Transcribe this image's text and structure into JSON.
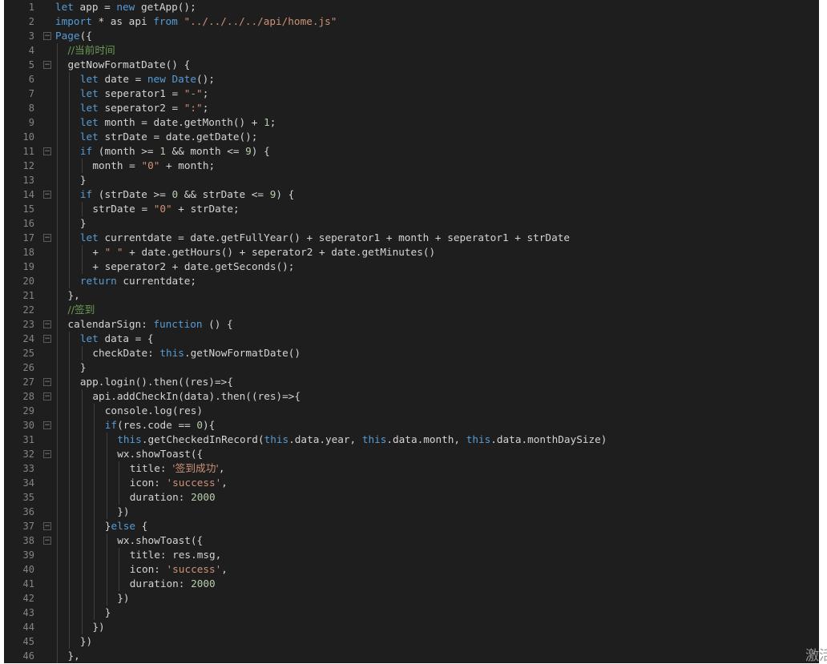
{
  "editor": {
    "colors": {
      "background": "#1e1e1e",
      "keyword": "#569cd6",
      "string": "#ce9178",
      "comment": "#6a9955",
      "number": "#b5cea8",
      "text": "#d4d4d4",
      "line_number": "#858585"
    },
    "fold_icon": "minus-box-icon",
    "lines": [
      {
        "n": "1",
        "fold": false,
        "indent": 0,
        "tokens": [
          [
            "kw",
            "let"
          ],
          [
            "pl",
            " app = "
          ],
          [
            "kw",
            "new"
          ],
          [
            "pl",
            " getApp();"
          ]
        ]
      },
      {
        "n": "2",
        "fold": false,
        "indent": 0,
        "tokens": [
          [
            "kw",
            "import"
          ],
          [
            "pl",
            " * as api "
          ],
          [
            "kw",
            "from"
          ],
          [
            "pl",
            " "
          ],
          [
            "str",
            "\"../../../../api/home.js\""
          ]
        ]
      },
      {
        "n": "3",
        "fold": true,
        "indent": 0,
        "tokens": [
          [
            "kw",
            "Page"
          ],
          [
            "pl",
            "({"
          ]
        ]
      },
      {
        "n": "4",
        "fold": false,
        "indent": 1,
        "tokens": [
          [
            "cm",
            "//当前时间"
          ]
        ]
      },
      {
        "n": "5",
        "fold": true,
        "indent": 1,
        "tokens": [
          [
            "pl",
            "getNowFormatDate() {"
          ]
        ]
      },
      {
        "n": "6",
        "fold": false,
        "indent": 2,
        "tokens": [
          [
            "kw",
            "let"
          ],
          [
            "pl",
            " date = "
          ],
          [
            "kw",
            "new"
          ],
          [
            "pl",
            " "
          ],
          [
            "kw",
            "Date"
          ],
          [
            "pl",
            "();"
          ]
        ]
      },
      {
        "n": "7",
        "fold": false,
        "indent": 2,
        "tokens": [
          [
            "kw",
            "let"
          ],
          [
            "pl",
            " seperator1 = "
          ],
          [
            "str",
            "\"-\""
          ],
          [
            "pl",
            ";"
          ]
        ]
      },
      {
        "n": "8",
        "fold": false,
        "indent": 2,
        "tokens": [
          [
            "kw",
            "let"
          ],
          [
            "pl",
            " seperator2 = "
          ],
          [
            "str",
            "\":\""
          ],
          [
            "pl",
            ";"
          ]
        ]
      },
      {
        "n": "9",
        "fold": false,
        "indent": 2,
        "tokens": [
          [
            "kw",
            "let"
          ],
          [
            "pl",
            " month = date.getMonth() + "
          ],
          [
            "num",
            "1"
          ],
          [
            "pl",
            ";"
          ]
        ]
      },
      {
        "n": "10",
        "fold": false,
        "indent": 2,
        "tokens": [
          [
            "kw",
            "let"
          ],
          [
            "pl",
            " strDate = date.getDate();"
          ]
        ]
      },
      {
        "n": "11",
        "fold": true,
        "indent": 2,
        "tokens": [
          [
            "kw",
            "if"
          ],
          [
            "pl",
            " (month >= "
          ],
          [
            "num",
            "1"
          ],
          [
            "pl",
            " && month <= "
          ],
          [
            "num",
            "9"
          ],
          [
            "pl",
            ") {"
          ]
        ]
      },
      {
        "n": "12",
        "fold": false,
        "indent": 3,
        "tokens": [
          [
            "pl",
            "month = "
          ],
          [
            "str",
            "\"0\""
          ],
          [
            "pl",
            " + month;"
          ]
        ]
      },
      {
        "n": "13",
        "fold": false,
        "indent": 2,
        "tokens": [
          [
            "pl",
            "}"
          ]
        ]
      },
      {
        "n": "14",
        "fold": true,
        "indent": 2,
        "tokens": [
          [
            "kw",
            "if"
          ],
          [
            "pl",
            " (strDate >= "
          ],
          [
            "num",
            "0"
          ],
          [
            "pl",
            " && strDate <= "
          ],
          [
            "num",
            "9"
          ],
          [
            "pl",
            ") {"
          ]
        ]
      },
      {
        "n": "15",
        "fold": false,
        "indent": 3,
        "tokens": [
          [
            "pl",
            "strDate = "
          ],
          [
            "str",
            "\"0\""
          ],
          [
            "pl",
            " + strDate;"
          ]
        ]
      },
      {
        "n": "16",
        "fold": false,
        "indent": 2,
        "tokens": [
          [
            "pl",
            "}"
          ]
        ]
      },
      {
        "n": "17",
        "fold": true,
        "indent": 2,
        "tokens": [
          [
            "kw",
            "let"
          ],
          [
            "pl",
            " currentdate = date.getFullYear() + seperator1 + month + seperator1 + strDate"
          ]
        ]
      },
      {
        "n": "18",
        "fold": false,
        "indent": 3,
        "tokens": [
          [
            "pl",
            "+ "
          ],
          [
            "str",
            "\" \""
          ],
          [
            "pl",
            " + date.getHours() + seperator2 + date.getMinutes()"
          ]
        ]
      },
      {
        "n": "19",
        "fold": false,
        "indent": 3,
        "tokens": [
          [
            "pl",
            "+ seperator2 + date.getSeconds();"
          ]
        ]
      },
      {
        "n": "20",
        "fold": false,
        "indent": 2,
        "tokens": [
          [
            "kw",
            "return"
          ],
          [
            "pl",
            " currentdate;"
          ]
        ]
      },
      {
        "n": "21",
        "fold": false,
        "indent": 1,
        "tokens": [
          [
            "pl",
            "},"
          ]
        ]
      },
      {
        "n": "22",
        "fold": false,
        "indent": 1,
        "tokens": [
          [
            "cm",
            "//签到"
          ]
        ]
      },
      {
        "n": "23",
        "fold": true,
        "indent": 1,
        "tokens": [
          [
            "pl",
            "calendarSign: "
          ],
          [
            "kw",
            "function"
          ],
          [
            "pl",
            " () {"
          ]
        ]
      },
      {
        "n": "24",
        "fold": true,
        "indent": 2,
        "tokens": [
          [
            "kw",
            "let"
          ],
          [
            "pl",
            " data = {"
          ]
        ]
      },
      {
        "n": "25",
        "fold": false,
        "indent": 3,
        "tokens": [
          [
            "pl",
            "checkDate: "
          ],
          [
            "kw",
            "this"
          ],
          [
            "pl",
            ".getNowFormatDate()"
          ]
        ]
      },
      {
        "n": "26",
        "fold": false,
        "indent": 2,
        "tokens": [
          [
            "pl",
            "}"
          ]
        ]
      },
      {
        "n": "27",
        "fold": true,
        "indent": 2,
        "tokens": [
          [
            "pl",
            "app.login().then((res)=>{"
          ]
        ]
      },
      {
        "n": "28",
        "fold": true,
        "indent": 3,
        "tokens": [
          [
            "pl",
            "api.addCheckIn(data).then((res)=>{"
          ]
        ]
      },
      {
        "n": "29",
        "fold": false,
        "indent": 4,
        "tokens": [
          [
            "pl",
            "console.log(res)"
          ]
        ]
      },
      {
        "n": "30",
        "fold": true,
        "indent": 4,
        "tokens": [
          [
            "kw",
            "if"
          ],
          [
            "pl",
            "(res.code == "
          ],
          [
            "num",
            "0"
          ],
          [
            "pl",
            "){"
          ]
        ]
      },
      {
        "n": "31",
        "fold": false,
        "indent": 5,
        "tokens": [
          [
            "kw",
            "this"
          ],
          [
            "pl",
            ".getCheckedInRecord("
          ],
          [
            "kw",
            "this"
          ],
          [
            "pl",
            ".data.year, "
          ],
          [
            "kw",
            "this"
          ],
          [
            "pl",
            ".data.month, "
          ],
          [
            "kw",
            "this"
          ],
          [
            "pl",
            ".data.monthDaySize)"
          ]
        ]
      },
      {
        "n": "32",
        "fold": true,
        "indent": 5,
        "tokens": [
          [
            "pl",
            "wx.showToast({"
          ]
        ]
      },
      {
        "n": "33",
        "fold": false,
        "indent": 6,
        "tokens": [
          [
            "pl",
            "title: "
          ],
          [
            "str",
            "'签到成功'"
          ],
          [
            "pl",
            ","
          ]
        ]
      },
      {
        "n": "34",
        "fold": false,
        "indent": 6,
        "tokens": [
          [
            "pl",
            "icon: "
          ],
          [
            "str",
            "'success'"
          ],
          [
            "pl",
            ","
          ]
        ]
      },
      {
        "n": "35",
        "fold": false,
        "indent": 6,
        "tokens": [
          [
            "pl",
            "duration: "
          ],
          [
            "num",
            "2000"
          ]
        ]
      },
      {
        "n": "36",
        "fold": false,
        "indent": 5,
        "tokens": [
          [
            "pl",
            "})"
          ]
        ]
      },
      {
        "n": "37",
        "fold": true,
        "indent": 4,
        "tokens": [
          [
            "pl",
            "}"
          ],
          [
            "kw",
            "else"
          ],
          [
            "pl",
            " {"
          ]
        ]
      },
      {
        "n": "38",
        "fold": true,
        "indent": 5,
        "tokens": [
          [
            "pl",
            "wx.showToast({"
          ]
        ]
      },
      {
        "n": "39",
        "fold": false,
        "indent": 6,
        "tokens": [
          [
            "pl",
            "title: res.msg,"
          ]
        ]
      },
      {
        "n": "40",
        "fold": false,
        "indent": 6,
        "tokens": [
          [
            "pl",
            "icon: "
          ],
          [
            "str",
            "'success'"
          ],
          [
            "pl",
            ","
          ]
        ]
      },
      {
        "n": "41",
        "fold": false,
        "indent": 6,
        "tokens": [
          [
            "pl",
            "duration: "
          ],
          [
            "num",
            "2000"
          ]
        ]
      },
      {
        "n": "42",
        "fold": false,
        "indent": 5,
        "tokens": [
          [
            "pl",
            "})"
          ]
        ]
      },
      {
        "n": "43",
        "fold": false,
        "indent": 4,
        "tokens": [
          [
            "pl",
            "}"
          ]
        ]
      },
      {
        "n": "44",
        "fold": false,
        "indent": 3,
        "tokens": [
          [
            "pl",
            "})"
          ]
        ]
      },
      {
        "n": "45",
        "fold": false,
        "indent": 2,
        "tokens": [
          [
            "pl",
            "})"
          ]
        ]
      },
      {
        "n": "46",
        "fold": false,
        "indent": 1,
        "tokens": [
          [
            "pl",
            "},"
          ]
        ]
      }
    ]
  },
  "watermark": {
    "text": "激活"
  }
}
